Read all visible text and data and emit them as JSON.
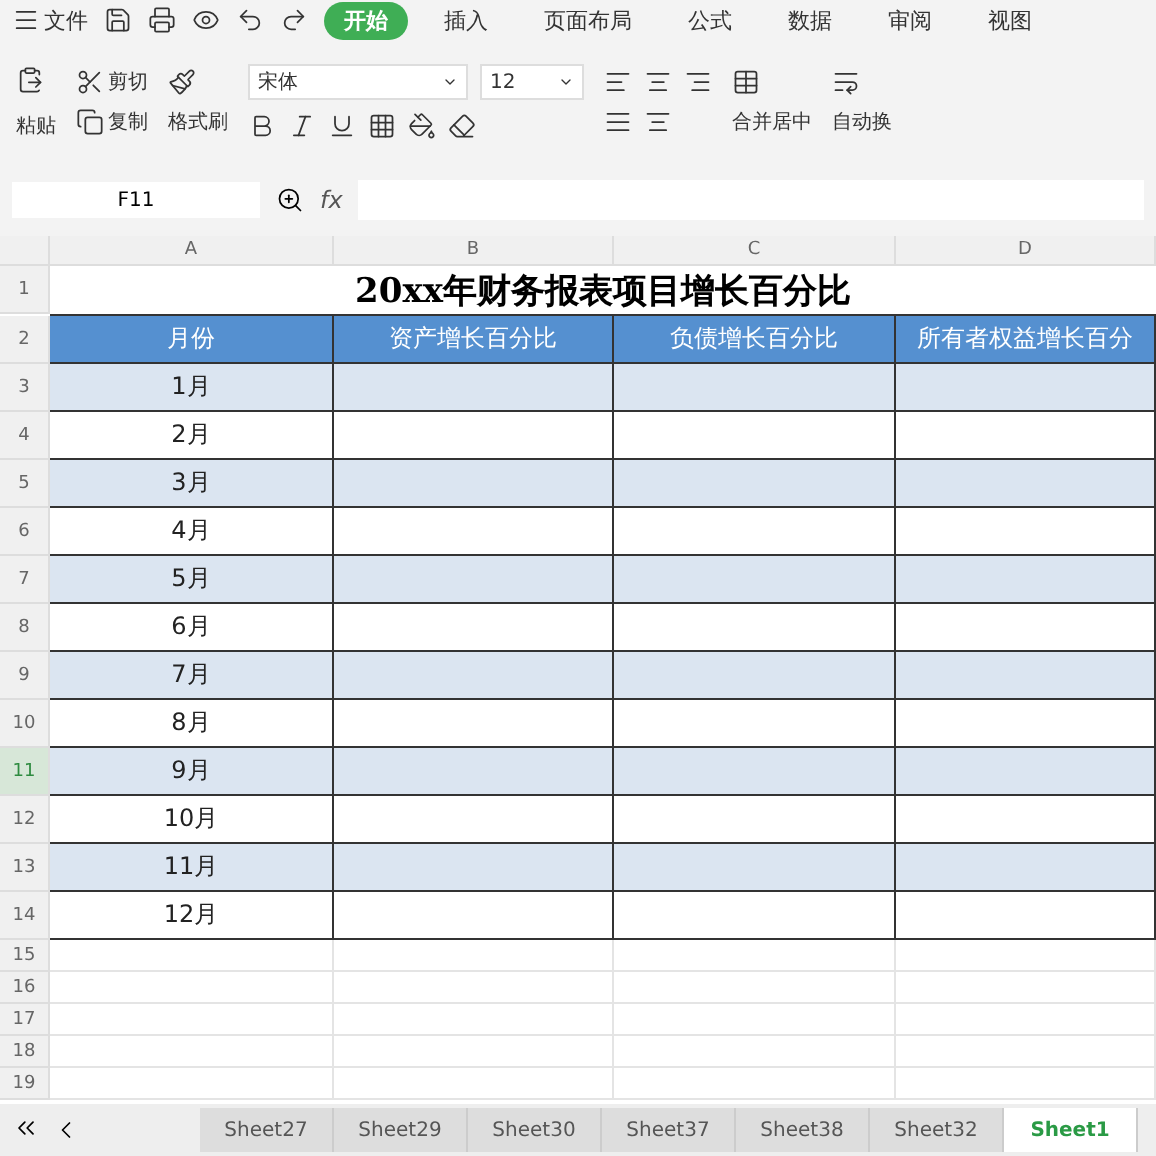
{
  "menu": {
    "file": "文件",
    "tabs": [
      {
        "label": "开始",
        "selected": true
      },
      {
        "label": "插入",
        "selected": false
      },
      {
        "label": "页面布局",
        "selected": false
      },
      {
        "label": "公式",
        "selected": false
      },
      {
        "label": "数据",
        "selected": false
      },
      {
        "label": "审阅",
        "selected": false
      },
      {
        "label": "视图",
        "selected": false
      }
    ]
  },
  "toolbar": {
    "paste": "粘贴",
    "cut": "剪切",
    "copy": "复制",
    "format_painter": "格式刷",
    "font": "宋体",
    "size": "12",
    "merge": "合并居中",
    "wrap": "自动换"
  },
  "formula_bar": {
    "name_box": "F11",
    "fx": "fx"
  },
  "columns": [
    "A",
    "B",
    "C",
    "D"
  ],
  "sheet": {
    "title": "20xx年财务报表项目增长百分比",
    "headers": [
      "月份",
      "资产增长百分比",
      "负债增长百分比",
      "所有者权益增长百分"
    ],
    "rows": [
      "1月",
      "2月",
      "3月",
      "4月",
      "5月",
      "6月",
      "7月",
      "8月",
      "9月",
      "10月",
      "11月",
      "12月"
    ],
    "row_numbers": [
      {
        "label": "1",
        "selected": false
      },
      {
        "label": "2",
        "selected": false
      },
      {
        "label": "3",
        "selected": false
      },
      {
        "label": "4",
        "selected": false
      },
      {
        "label": "5",
        "selected": false
      },
      {
        "label": "6",
        "selected": false
      },
      {
        "label": "7",
        "selected": false
      },
      {
        "label": "8",
        "selected": false
      },
      {
        "label": "9",
        "selected": false
      },
      {
        "label": "10",
        "selected": false
      },
      {
        "label": "11",
        "selected": true
      },
      {
        "label": "12",
        "selected": false
      },
      {
        "label": "13",
        "selected": false
      },
      {
        "label": "14",
        "selected": false
      },
      {
        "label": "15",
        "selected": false
      },
      {
        "label": "16",
        "selected": false
      },
      {
        "label": "17",
        "selected": false
      },
      {
        "label": "18",
        "selected": false
      },
      {
        "label": "19",
        "selected": false
      }
    ]
  },
  "sheet_tabs": [
    {
      "label": "Sheet27",
      "selected": false
    },
    {
      "label": "Sheet29",
      "selected": false
    },
    {
      "label": "Sheet30",
      "selected": false
    },
    {
      "label": "Sheet37",
      "selected": false
    },
    {
      "label": "Sheet38",
      "selected": false
    },
    {
      "label": "Sheet32",
      "selected": false
    },
    {
      "label": "Sheet1",
      "selected": true
    }
  ]
}
